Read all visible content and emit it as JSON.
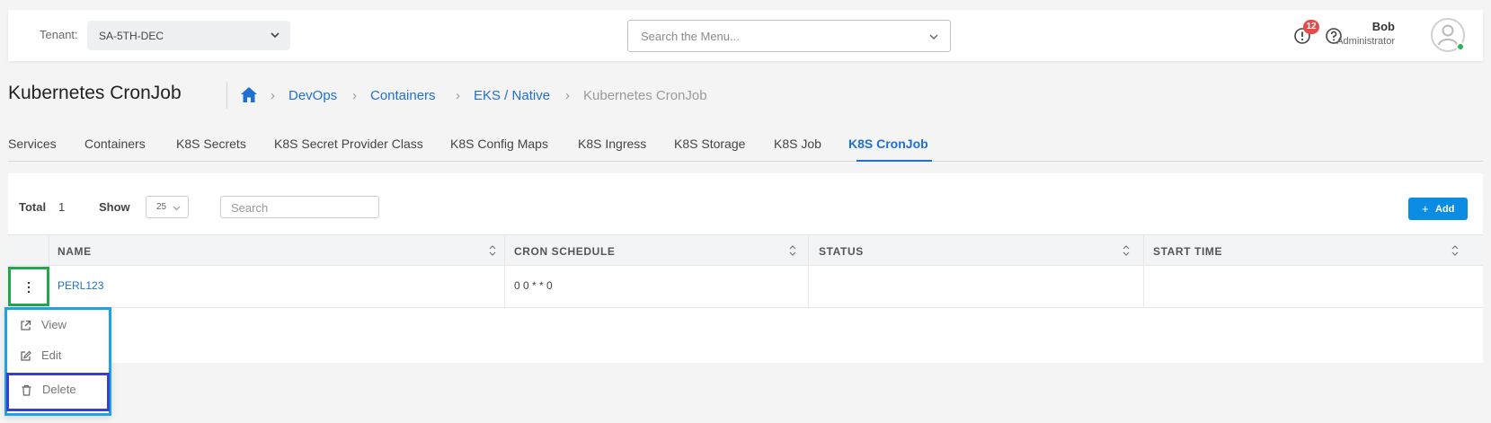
{
  "header": {
    "tenant_label": "Tenant:",
    "tenant_value": "SA-5TH-DEC",
    "menu_search_placeholder": "Search the Menu...",
    "notification_count": "12",
    "user_name": "Bob",
    "user_role": "Administrator"
  },
  "page": {
    "title": "Kubernetes CronJob",
    "breadcrumb": [
      "DevOps",
      "Containers",
      "EKS / Native",
      "Kubernetes CronJob"
    ]
  },
  "tabs": [
    {
      "label": "Services"
    },
    {
      "label": "Containers"
    },
    {
      "label": "K8S Secrets"
    },
    {
      "label": "K8S Secret Provider Class"
    },
    {
      "label": "K8S Config Maps"
    },
    {
      "label": "K8S Ingress"
    },
    {
      "label": "K8S Storage"
    },
    {
      "label": "K8S Job"
    },
    {
      "label": "K8S CronJob",
      "active": true
    }
  ],
  "toolbar": {
    "total_label": "Total",
    "total_value": "1",
    "show_label": "Show",
    "page_size": "25",
    "search_placeholder": "Search",
    "add_label": "Add"
  },
  "table": {
    "columns": [
      "NAME",
      "CRON SCHEDULE",
      "STATUS",
      "START TIME"
    ],
    "rows": [
      {
        "name": "PERL123",
        "cron_schedule": "0 0 * * 0",
        "status": "",
        "start_time": ""
      }
    ]
  },
  "context_menu": {
    "items": [
      "View",
      "Edit",
      "Delete"
    ]
  },
  "colors": {
    "accent": "#1f6fd1",
    "add_button": "#0b8de3",
    "badge": "#e24c4b",
    "online": "#2ab55c",
    "highlight_green": "#1fa84a",
    "highlight_cyan": "#1aa3e8",
    "highlight_indigo": "#3a40c8"
  }
}
